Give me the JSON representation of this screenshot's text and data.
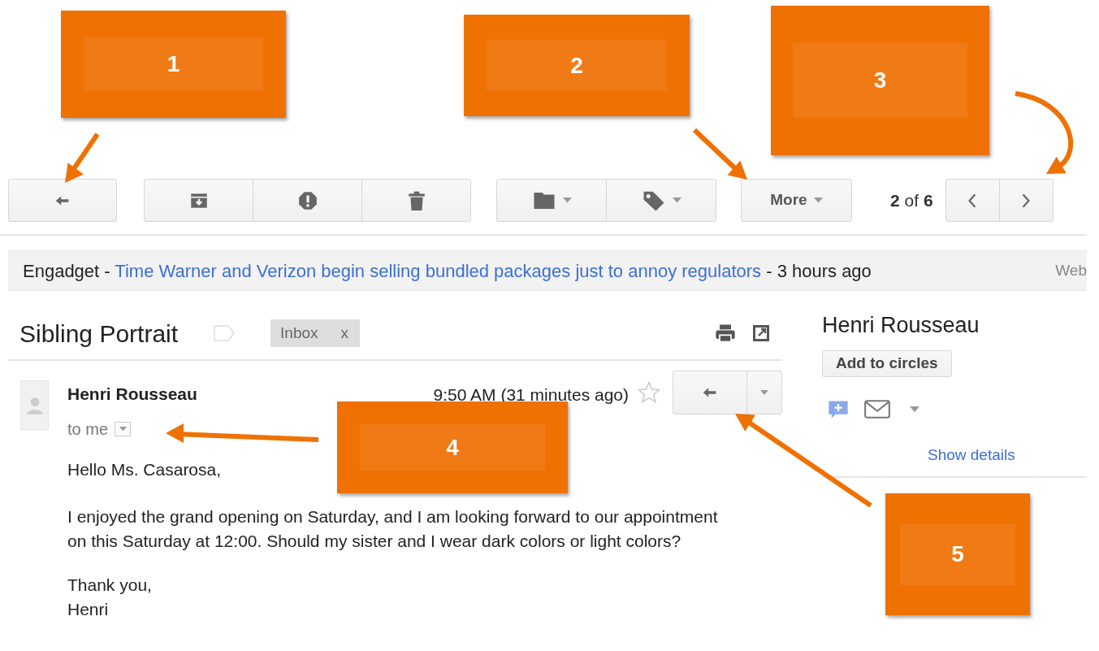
{
  "toolbar": {
    "groups": [
      {
        "buttons": [
          {
            "kind": "reply",
            "menu": false
          }
        ]
      },
      {
        "buttons": [
          {
            "kind": "archive",
            "menu": false
          },
          {
            "kind": "spam",
            "menu": false
          },
          {
            "kind": "delete",
            "menu": false
          }
        ]
      },
      {
        "buttons": [
          {
            "kind": "move",
            "menu": true
          },
          {
            "kind": "labels",
            "menu": true
          }
        ]
      },
      {
        "buttons": [
          {
            "kind": "more",
            "label": "More",
            "menu": true
          }
        ]
      }
    ],
    "pager": {
      "text": "**2** of **6**",
      "buttons": [
        {
          "kind": "prev"
        },
        {
          "kind": "next"
        }
      ]
    }
  },
  "web_clip": {
    "prefix": "Engadget -",
    "link": "Time Warner and Verizon begin selling bundled packages just to annoy regulators",
    "suffix": "- 3 hours ago",
    "right": "Web"
  },
  "subject": {
    "title": "Sibling Portrait",
    "labels": [
      {
        "text": "Inbox",
        "remove": "x"
      }
    ]
  },
  "message": {
    "sender": "Henri Rousseau",
    "recipient": "to me",
    "time": "9:50 AM (31 minutes ago)",
    "body": [
      [
        "Hello Ms. Casarosa,"
      ],
      [
        "I enjoyed the grand opening on Saturday, and I am looking forward to our appointment on this Saturday at 12:00. Should my sister and I wear dark colors or light colors?"
      ],
      [
        "Thank you,",
        "Henri"
      ]
    ]
  },
  "contact": {
    "name": "Henri Rousseau",
    "button": "Add to circles",
    "link": "Show details"
  },
  "callouts": [
    {
      "number": "1"
    },
    {
      "number": "2"
    },
    {
      "number": "3"
    },
    {
      "number": "4"
    },
    {
      "number": "5"
    }
  ]
}
